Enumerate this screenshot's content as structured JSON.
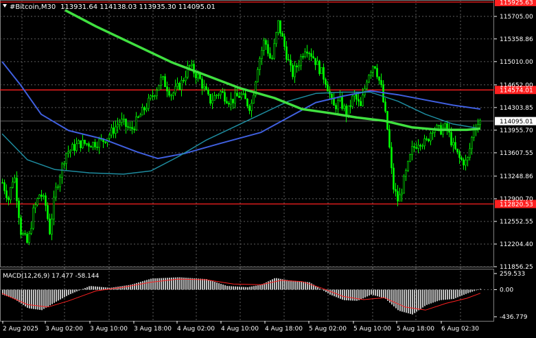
{
  "header": {
    "symbol_label": "#Bitcoin,M30",
    "ohlc_text": "113931.64 114138.03 113935.30 114095.01"
  },
  "price_axis": {
    "ticks": [
      "115705.00",
      "115358.86",
      "115010.00",
      "114652.00",
      "114303.85",
      "113955.70",
      "113607.55",
      "113248.86",
      "112900.70",
      "112552.55",
      "112204.40",
      "111856.25"
    ]
  },
  "levels": [
    {
      "label": "115925.63",
      "price": 115925.63,
      "color": "#ff2020"
    },
    {
      "label": "114574.01",
      "price": 114574.01,
      "color": "#ff2020"
    },
    {
      "label": "112820.53",
      "price": 112820.53,
      "color": "#ff2020"
    }
  ],
  "current_price": {
    "label": "114095.01",
    "price": 114095.01
  },
  "macd": {
    "label": "MACD(12,26,9) 17.477 -58.144",
    "ticks": [
      "259.533",
      "0.00",
      "-436.779"
    ]
  },
  "time_axis": {
    "labels": [
      "2 Aug 2025",
      "3 Aug 02:00",
      "3 Aug 10:00",
      "3 Aug 18:00",
      "4 Aug 02:00",
      "4 Aug 10:00",
      "4 Aug 18:00",
      "5 Aug 02:00",
      "5 Aug 10:00",
      "5 Aug 18:00",
      "6 Aug 02:30"
    ]
  },
  "colors": {
    "background": "#000000",
    "candle": "#00ff00",
    "grid": "#606060",
    "ma_fast": "#40e040",
    "ma_mid": "#1e8ca0",
    "ma_slow": "#4060e0",
    "level_line": "#ff2020",
    "macd_hist": "#c0c0c0",
    "macd_signal": "#ff2020",
    "axis_text": "#ffffff"
  },
  "chart_data": {
    "type": "candlestick",
    "timeframe": "M30",
    "ylim": [
      111856.25,
      115925.63
    ],
    "series": [
      {
        "kind": "price_close",
        "x": [
          "2 Aug 2025",
          "3 Aug 02:00",
          "3 Aug 10:00",
          "3 Aug 18:00",
          "4 Aug 02:00",
          "4 Aug 10:00",
          "4 Aug 18:00",
          "5 Aug 02:00",
          "5 Aug 10:00",
          "5 Aug 18:00",
          "6 Aug 02:30"
        ],
        "values": [
          113150,
          112700,
          113650,
          113900,
          114800,
          114300,
          115300,
          114500,
          114450,
          113200,
          114095
        ]
      },
      {
        "kind": "ma_slow",
        "values": [
          115010,
          114100,
          113720,
          113540,
          113680,
          113820,
          113950,
          114300,
          114550,
          114450,
          114280
        ]
      },
      {
        "kind": "ma_mid",
        "values": [
          113950,
          113480,
          113380,
          113450,
          113900,
          114300,
          114500,
          114700,
          114650,
          114300,
          113960
        ]
      },
      {
        "kind": "ma_fast",
        "values": [
          null,
          115700,
          115400,
          115100,
          114800,
          114600,
          114400,
          114200,
          114100,
          114000,
          113980
        ]
      }
    ]
  }
}
